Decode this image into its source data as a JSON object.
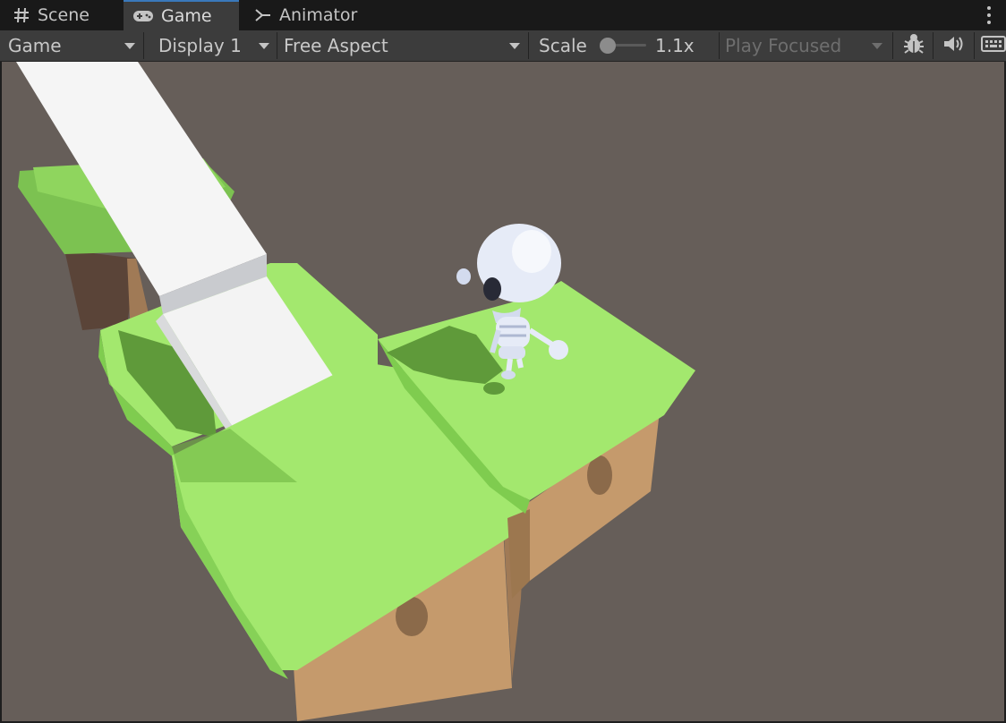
{
  "tabs": [
    {
      "label": "Scene",
      "icon": "grid-hash-icon"
    },
    {
      "label": "Game",
      "icon": "gamepad-icon",
      "active": true
    },
    {
      "label": "Animator",
      "icon": "animator-icon"
    }
  ],
  "toolbar": {
    "view_select": "Game",
    "display_select": "Display 1",
    "aspect_select": "Free Aspect",
    "scale_label": "Scale",
    "scale_value": "1.1x",
    "play_mode_select": "Play Focused"
  },
  "colors": {
    "tab_accent": "#3a79bb",
    "viewport_bg": "#665e59",
    "grass": "#a3e86e",
    "dirt": "#c59a6c",
    "skeleton": "#e6ebf7"
  }
}
